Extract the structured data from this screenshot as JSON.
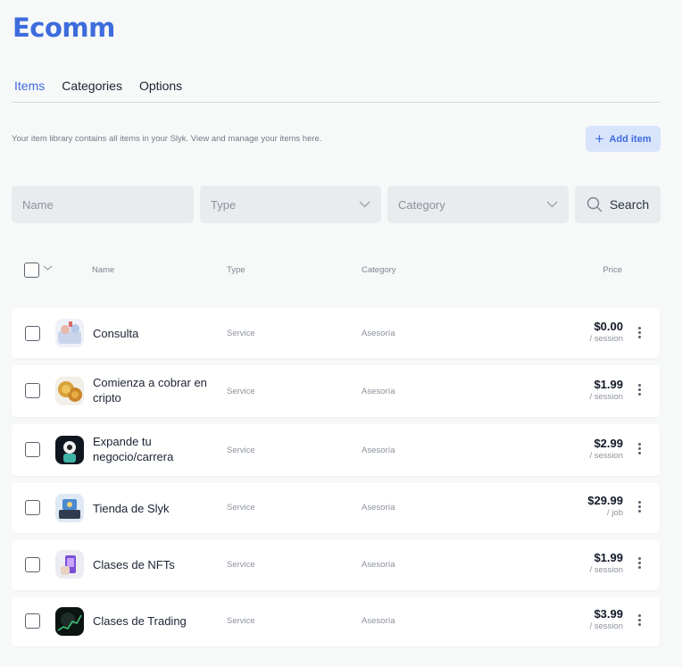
{
  "app": {
    "title": "Ecomm"
  },
  "tabs": [
    {
      "label": "Items"
    },
    {
      "label": "Categories"
    },
    {
      "label": "Options"
    }
  ],
  "description": "Your item library contains all items in your Slyk. View and manage your items here.",
  "add_button": {
    "label": "Add item"
  },
  "filters": {
    "name_placeholder": "Name",
    "type_placeholder": "Type",
    "category_placeholder": "Category",
    "search_label": "Search"
  },
  "table": {
    "headers": {
      "name": "Name",
      "type": "Type",
      "category": "Category",
      "price": "Price"
    },
    "rows": [
      {
        "name": "Consulta",
        "type": "Service",
        "category": "Asesoría",
        "price": "$0.00",
        "unit": "/ session"
      },
      {
        "name": "Comienza a cobrar en cripto",
        "type": "Service",
        "category": "Asesoría",
        "price": "$1.99",
        "unit": "/ session"
      },
      {
        "name": "Expande tu negocio/carrera",
        "type": "Service",
        "category": "Asesoría",
        "price": "$2.99",
        "unit": "/ session"
      },
      {
        "name": "Tienda de Slyk",
        "type": "Service",
        "category": "Asesoría",
        "price": "$29.99",
        "unit": "/ job"
      },
      {
        "name": "Clases de NFTs",
        "type": "Service",
        "category": "Asesoría",
        "price": "$1.99",
        "unit": "/ session"
      },
      {
        "name": "Clases de Trading",
        "type": "Service",
        "category": "Asesoría",
        "price": "$3.99",
        "unit": "/ session"
      }
    ]
  },
  "colors": {
    "accent": "#3d6cdc",
    "accent_light": "#d8e4fb",
    "background": "#f7f9f9"
  }
}
